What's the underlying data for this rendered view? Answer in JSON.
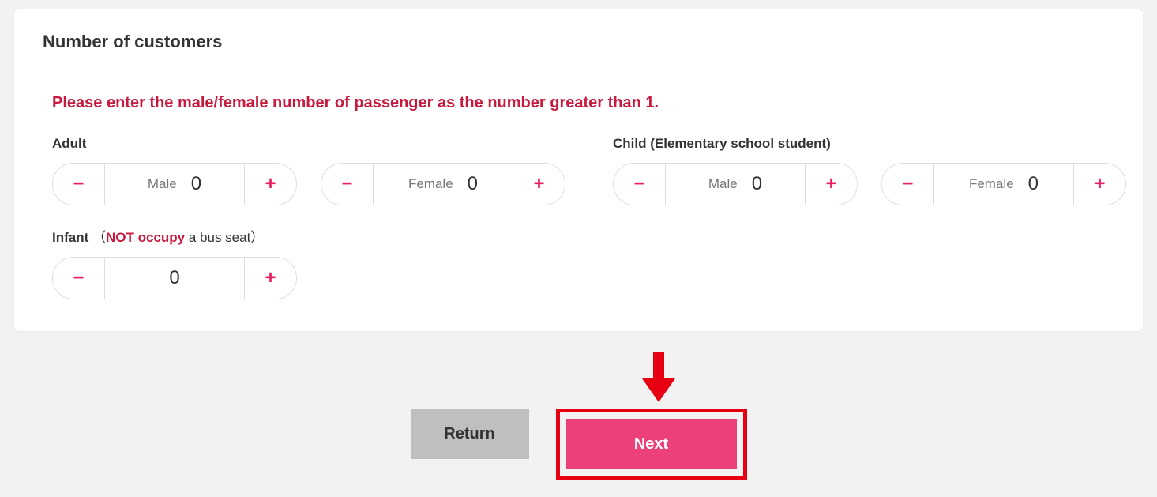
{
  "header": {
    "title": "Number of customers"
  },
  "error": "Please enter the male/female number of passenger as the number greater than 1.",
  "adult": {
    "label": "Adult",
    "male": {
      "label": "Male",
      "value": "0"
    },
    "female": {
      "label": "Female",
      "value": "0"
    }
  },
  "child": {
    "label": "Child (Elementary school student)",
    "male": {
      "label": "Male",
      "value": "0"
    },
    "female": {
      "label": "Female",
      "value": "0"
    }
  },
  "infant": {
    "label_prefix": "Infant",
    "paren_open": "（",
    "highlight": "NOT occupy",
    "label_suffix": " a bus seat）",
    "value": "0"
  },
  "actions": {
    "return_label": "Return",
    "next_label": "Next"
  },
  "icons": {
    "minus": "−",
    "plus": "+"
  }
}
